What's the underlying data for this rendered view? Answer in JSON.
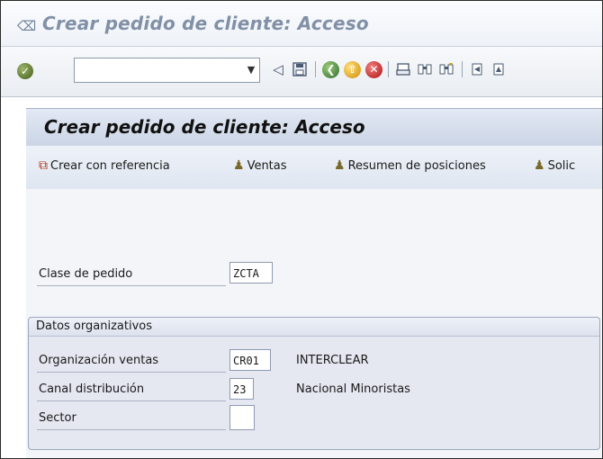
{
  "window": {
    "title": "Crear pedido de cliente: Acceso"
  },
  "toolbar": {
    "command_field": {
      "value": "",
      "placeholder": ""
    },
    "icons": [
      "enter-icon",
      "back-icon",
      "save-icon",
      "back-nav-icon",
      "exit-icon",
      "cancel-icon",
      "print-icon",
      "find-icon",
      "find-next-icon",
      "first-page-icon",
      "previous-page-icon"
    ]
  },
  "content": {
    "title": "Crear pedido de cliente: Acceso",
    "app_toolbar": {
      "create_with_ref": "Crear con referencia",
      "sales": "Ventas",
      "item_overview": "Resumen de posiciones",
      "sold_to": "Solic"
    },
    "order_type": {
      "label": "Clase de pedido",
      "value": "ZCTA"
    },
    "org_data": {
      "title": "Datos organizativos",
      "sales_org": {
        "label": "Organización ventas",
        "value": "CR01",
        "desc": "INTERCLEAR"
      },
      "distribution_channel": {
        "label": "Canal distribución",
        "value": "23",
        "desc": "Nacional Minoristas"
      },
      "division": {
        "label": "Sector",
        "value": ""
      }
    }
  }
}
